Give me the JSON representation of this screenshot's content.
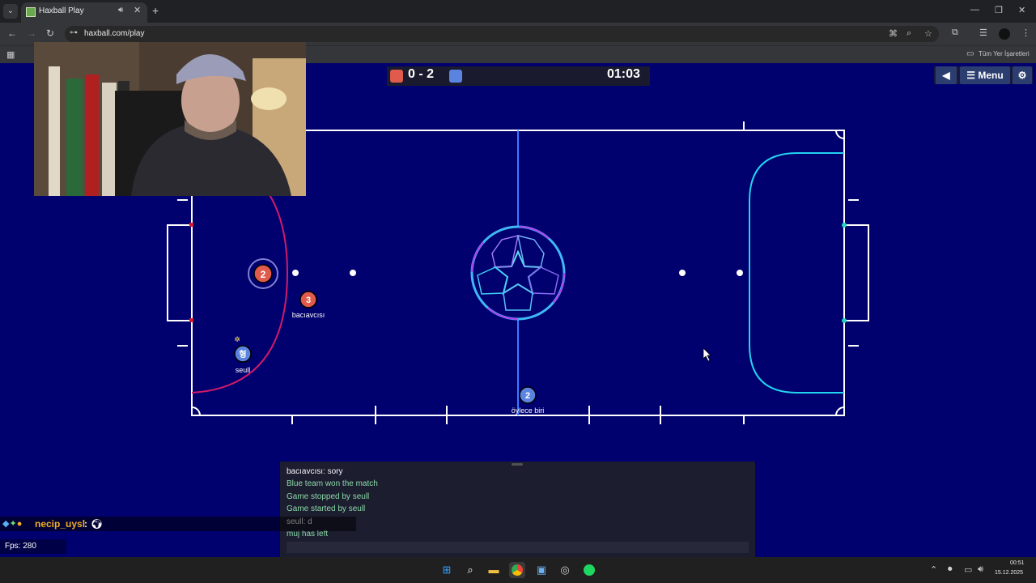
{
  "browser": {
    "tab_menu_icon": "chevron-down-icon",
    "tab_title": "Haxball Play",
    "url": "haxball.com/play",
    "bookmark_folder": "Tüm Yer İşaretleri"
  },
  "game": {
    "score": "0 - 2",
    "timer": "01:03",
    "red_color": "#e05b4b",
    "blue_color": "#5b84e0",
    "menu_label": "Menu",
    "players": [
      {
        "number": "2",
        "team": "red",
        "name": ""
      },
      {
        "number": "3",
        "team": "red",
        "name": "bacıavcısı"
      },
      {
        "number": "형",
        "team": "blue",
        "name": "seull"
      },
      {
        "number": "2",
        "team": "blue",
        "name": "öylece biri"
      }
    ]
  },
  "chat": {
    "lines": [
      {
        "text": "bacıavcısı: sory",
        "type": "player"
      },
      {
        "text": "Blue team won the match",
        "type": "system"
      },
      {
        "text": "Game stopped by seull",
        "type": "system"
      },
      {
        "text": "Game started by seull",
        "type": "system"
      },
      {
        "text": "seull: d",
        "type": "player"
      },
      {
        "text": "muj has left",
        "type": "system"
      }
    ]
  },
  "overlay": {
    "stream_username": "necip_uysl",
    "stream_separator": ":",
    "fps": "Fps: 280"
  },
  "taskbar": {
    "time": "00:51",
    "date": "15.12.2025"
  }
}
